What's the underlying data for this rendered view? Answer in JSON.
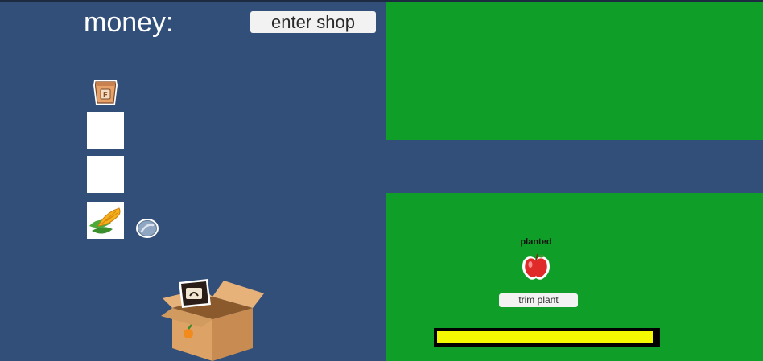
{
  "hud": {
    "money_label": "money:",
    "shop_button_label": "enter shop"
  },
  "inventory": {
    "slots": [
      {
        "item": "fertilizer-bag-icon",
        "letter": "F"
      },
      {
        "item": "empty"
      },
      {
        "item": "empty"
      },
      {
        "item": "corn-icon"
      }
    ],
    "coin_icon": "coin-icon"
  },
  "plot": {
    "status": "planted",
    "crop_icon": "apple-icon",
    "trim_button_label": "trim plant",
    "growth_progress": 0.98
  },
  "colors": {
    "background": "#324f7a",
    "field": "#0f9e27",
    "progress_fill": "#f4f800"
  }
}
